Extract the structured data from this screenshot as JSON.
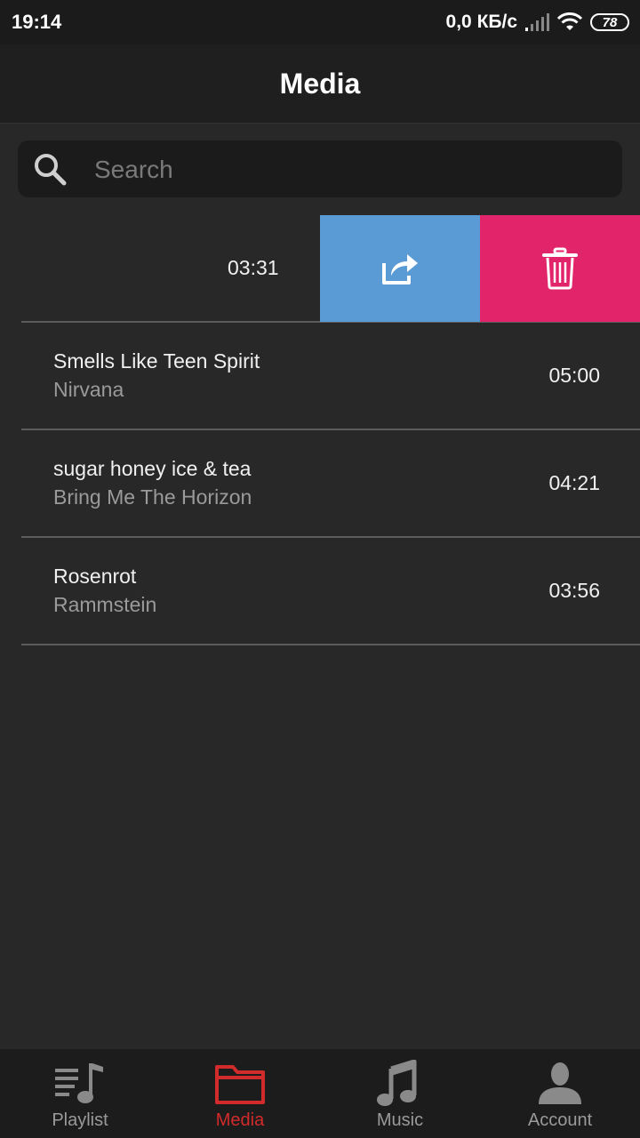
{
  "status_bar": {
    "time": "19:14",
    "speed": "0,0 КБ/с",
    "battery": "78"
  },
  "header": {
    "title": "Media"
  },
  "search": {
    "placeholder": "Search",
    "value": ""
  },
  "swiped_row": {
    "duration": "03:31",
    "share_icon": "share-icon",
    "delete_icon": "trash-icon"
  },
  "songs": [
    {
      "title": "Smells Like Teen Spirit",
      "artist": "Nirvana",
      "duration": "05:00"
    },
    {
      "title": "sugar honey ice & tea",
      "artist": "Bring Me The Horizon",
      "duration": "04:21"
    },
    {
      "title": "Rosenrot",
      "artist": "Rammstein",
      "duration": "03:56"
    }
  ],
  "nav": {
    "items": [
      {
        "label": "Playlist",
        "icon": "playlist-icon",
        "active": false
      },
      {
        "label": "Media",
        "icon": "folder-icon",
        "active": true
      },
      {
        "label": "Music",
        "icon": "music-note-icon",
        "active": false
      },
      {
        "label": "Account",
        "icon": "account-icon",
        "active": false
      }
    ]
  },
  "colors": {
    "background": "#282828",
    "share": "#5b9bd5",
    "delete": "#e2246b",
    "accent": "#d22b2b"
  }
}
